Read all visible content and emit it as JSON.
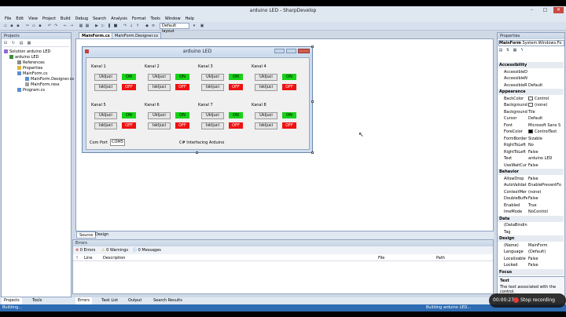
{
  "window": {
    "title": "arduino LED - SharpDevelop",
    "minimize": "–",
    "maximize": "□",
    "close": "✕"
  },
  "menu": [
    "File",
    "Edit",
    "View",
    "Project",
    "Build",
    "Debug",
    "Search",
    "Analysis",
    "Format",
    "Tools",
    "Window",
    "Help"
  ],
  "toolbar": {
    "layout": "Default layout"
  },
  "projects": {
    "title": "Projects",
    "items": [
      "Solution arduino LED",
      "arduino LED",
      "References",
      "Properties",
      "MainForm.cs",
      "MainForm.Designer.cs",
      "MainForm.resx",
      "Program.cs"
    ]
  },
  "doc": {
    "tabs": [
      "MainForm.cs",
      "MainForm.Designer.cs"
    ],
    "bottom_tabs": [
      "Source",
      "Design"
    ]
  },
  "form": {
    "title": "arduino LED",
    "channels": [
      {
        "label": "Kanal 1",
        "on": "Ukljuci",
        "off": "Iskljuci",
        "state_on": "ON",
        "state_off": "OFF"
      },
      {
        "label": "Kanal 2",
        "on": "Ukljuci",
        "off": "Iskljuci",
        "state_on": "ON",
        "state_off": "OFF"
      },
      {
        "label": "Kanal 3",
        "on": "Ukljuci",
        "off": "Iskljuci",
        "state_on": "ON",
        "state_off": "OFF"
      },
      {
        "label": "Kanal 4",
        "on": "Ukljuci",
        "off": "Iskljuci",
        "state_on": "ON",
        "state_off": "OFF"
      },
      {
        "label": "Kanal 5",
        "on": "Ukljuci",
        "off": "Iskljuci",
        "state_on": "ON",
        "state_off": "OFF"
      },
      {
        "label": "Kanal 6",
        "on": "Ukljuci",
        "off": "Iskljuci",
        "state_on": "ON",
        "state_off": "OFF"
      },
      {
        "label": "Kanal 7",
        "on": "Ukljuci",
        "off": "Iskljuci",
        "state_on": "ON",
        "state_off": "OFF"
      },
      {
        "label": "Kanal 8",
        "on": "Ukljuci",
        "off": "Iskljuci",
        "state_on": "ON",
        "state_off": "OFF"
      }
    ],
    "com_label": "Com Port",
    "com_value": "COM5",
    "footer": "C# Interfacing Arduino"
  },
  "errors": {
    "title": "Errors",
    "tabs": [
      "0 Errors",
      "0 Warnings",
      "0 Messages"
    ],
    "columns": [
      "Line",
      "Description",
      "File",
      "Path"
    ]
  },
  "bottom_tabs": [
    "Projects",
    "Tools",
    "Errors",
    "Task List",
    "Output",
    "Search Results"
  ],
  "properties": {
    "title": "Properties",
    "object": "MainForm",
    "object_type": "System.Windows.Fo",
    "rows": [
      {
        "cat": "Accessibility"
      },
      {
        "k": "AccessibleD",
        "v": ""
      },
      {
        "k": "AccessibleN",
        "v": ""
      },
      {
        "k": "AccessibleR",
        "v": "Default"
      },
      {
        "cat": "Appearance"
      },
      {
        "k": "BackColor",
        "v": "Control",
        "sw": "#ffffff"
      },
      {
        "k": "Background",
        "v": "(none)",
        "sw": "#ffffff"
      },
      {
        "k": "Background",
        "v": "Tile"
      },
      {
        "k": "Cursor",
        "v": "Default"
      },
      {
        "k": "Font",
        "v": "Microsoft Sans S"
      },
      {
        "k": "ForeColor",
        "v": "ControlText",
        "sw": "#000000"
      },
      {
        "k": "FormBorder",
        "v": "Sizable"
      },
      {
        "k": "RightToLeft",
        "v": "No"
      },
      {
        "k": "RightToLeft",
        "v": "False"
      },
      {
        "k": "Text",
        "v": "arduino LED"
      },
      {
        "k": "UseWaitCur",
        "v": "False"
      },
      {
        "cat": "Behavior"
      },
      {
        "k": "AllowDrop",
        "v": "False"
      },
      {
        "k": "AutoValidat",
        "v": "EnablePreventFo"
      },
      {
        "k": "ContextMer",
        "v": "(none)"
      },
      {
        "k": "DoubleBuffe",
        "v": "False"
      },
      {
        "k": "Enabled",
        "v": "True"
      },
      {
        "k": "ImeMode",
        "v": "NoControl"
      },
      {
        "cat": "Data"
      },
      {
        "k": "(DataBindin",
        "v": ""
      },
      {
        "k": "Tag",
        "v": ""
      },
      {
        "cat": "Design"
      },
      {
        "k": "(Name)",
        "v": "MainForm"
      },
      {
        "k": "Language",
        "v": "(Default)"
      },
      {
        "k": "Localizable",
        "v": "False"
      },
      {
        "k": "Locked",
        "v": "False"
      },
      {
        "cat": "Focus"
      }
    ],
    "desc_title": "Text",
    "desc": "The text associated with the control."
  },
  "status": {
    "left": "Building...",
    "right": "Building arduino LED..."
  },
  "recording": {
    "time": "00:00:27",
    "label": "Stop recording"
  },
  "colors": {
    "on": "#18d018",
    "off": "#ee1111",
    "statusbar": "#2d6bb2"
  }
}
